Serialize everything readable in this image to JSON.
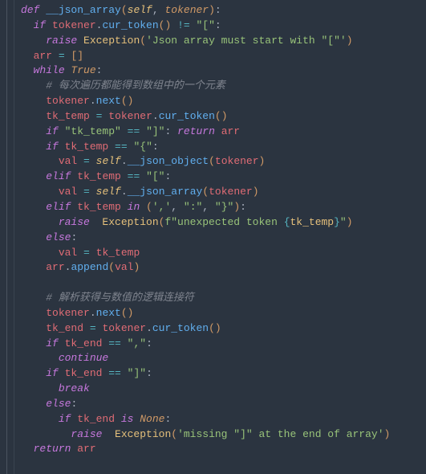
{
  "code": {
    "lines": [
      {
        "indent": 0,
        "tokens": [
          {
            "t": "def ",
            "c": "kw-def"
          },
          {
            "t": "__json_array",
            "c": "fn"
          },
          {
            "t": "(",
            "c": "brk"
          },
          {
            "t": "self",
            "c": "self"
          },
          {
            "t": ", ",
            "c": "punc"
          },
          {
            "t": "tokener",
            "c": "param"
          },
          {
            "t": ")",
            "c": "brk"
          },
          {
            "t": ":",
            "c": "punc"
          }
        ]
      },
      {
        "indent": 1,
        "tokens": [
          {
            "t": "if ",
            "c": "kw"
          },
          {
            "t": "tokener",
            "c": "var"
          },
          {
            "t": ".",
            "c": "punc"
          },
          {
            "t": "cur_token",
            "c": "call"
          },
          {
            "t": "() ",
            "c": "brk"
          },
          {
            "t": "!=",
            "c": "op"
          },
          {
            "t": " ",
            "c": "punc"
          },
          {
            "t": "\"[\"",
            "c": "str"
          },
          {
            "t": ":",
            "c": "punc"
          }
        ]
      },
      {
        "indent": 2,
        "tokens": [
          {
            "t": "raise ",
            "c": "kw"
          },
          {
            "t": "Exception",
            "c": "builtin"
          },
          {
            "t": "(",
            "c": "brk"
          },
          {
            "t": "'Json array must start with \"[\"'",
            "c": "str"
          },
          {
            "t": ")",
            "c": "brk"
          }
        ]
      },
      {
        "indent": 1,
        "tokens": [
          {
            "t": "arr ",
            "c": "var"
          },
          {
            "t": "=",
            "c": "op"
          },
          {
            "t": " []",
            "c": "brk"
          }
        ]
      },
      {
        "indent": 1,
        "tokens": [
          {
            "t": "while ",
            "c": "kw"
          },
          {
            "t": "True",
            "c": "none"
          },
          {
            "t": ":",
            "c": "punc"
          }
        ]
      },
      {
        "indent": 2,
        "tokens": [
          {
            "t": "# 每次遍历都能得到数组中的一个元素",
            "c": "comment"
          }
        ]
      },
      {
        "indent": 2,
        "tokens": [
          {
            "t": "tokener",
            "c": "var"
          },
          {
            "t": ".",
            "c": "punc"
          },
          {
            "t": "next",
            "c": "call"
          },
          {
            "t": "()",
            "c": "brk"
          }
        ]
      },
      {
        "indent": 2,
        "tokens": [
          {
            "t": "tk_temp ",
            "c": "var"
          },
          {
            "t": "=",
            "c": "op"
          },
          {
            "t": " ",
            "c": "punc"
          },
          {
            "t": "tokener",
            "c": "var"
          },
          {
            "t": ".",
            "c": "punc"
          },
          {
            "t": "cur_token",
            "c": "call"
          },
          {
            "t": "()",
            "c": "brk"
          }
        ]
      },
      {
        "indent": 2,
        "tokens": [
          {
            "t": "if ",
            "c": "kw"
          },
          {
            "t": "\"tk_temp\"",
            "c": "str"
          },
          {
            "t": " ",
            "c": "punc"
          },
          {
            "t": "==",
            "c": "op"
          },
          {
            "t": " ",
            "c": "punc"
          },
          {
            "t": "\"]\"",
            "c": "str"
          },
          {
            "t": ": ",
            "c": "punc"
          },
          {
            "t": "return ",
            "c": "kw"
          },
          {
            "t": "arr",
            "c": "var"
          }
        ]
      },
      {
        "indent": 2,
        "tokens": [
          {
            "t": "if ",
            "c": "kw"
          },
          {
            "t": "tk_temp ",
            "c": "var"
          },
          {
            "t": "==",
            "c": "op"
          },
          {
            "t": " ",
            "c": "punc"
          },
          {
            "t": "\"{\"",
            "c": "str"
          },
          {
            "t": ":",
            "c": "punc"
          }
        ]
      },
      {
        "indent": 3,
        "tokens": [
          {
            "t": "val ",
            "c": "var"
          },
          {
            "t": "=",
            "c": "op"
          },
          {
            "t": " ",
            "c": "punc"
          },
          {
            "t": "self",
            "c": "self"
          },
          {
            "t": ".",
            "c": "punc"
          },
          {
            "t": "__json_object",
            "c": "call"
          },
          {
            "t": "(",
            "c": "brk"
          },
          {
            "t": "tokener",
            "c": "var"
          },
          {
            "t": ")",
            "c": "brk"
          }
        ]
      },
      {
        "indent": 2,
        "tokens": [
          {
            "t": "elif ",
            "c": "kw"
          },
          {
            "t": "tk_temp ",
            "c": "var"
          },
          {
            "t": "==",
            "c": "op"
          },
          {
            "t": " ",
            "c": "punc"
          },
          {
            "t": "\"[\"",
            "c": "str"
          },
          {
            "t": ":",
            "c": "punc"
          }
        ]
      },
      {
        "indent": 3,
        "tokens": [
          {
            "t": "val ",
            "c": "var"
          },
          {
            "t": "=",
            "c": "op"
          },
          {
            "t": " ",
            "c": "punc"
          },
          {
            "t": "self",
            "c": "self"
          },
          {
            "t": ".",
            "c": "punc"
          },
          {
            "t": "__json_array",
            "c": "call"
          },
          {
            "t": "(",
            "c": "brk"
          },
          {
            "t": "tokener",
            "c": "var"
          },
          {
            "t": ")",
            "c": "brk"
          }
        ]
      },
      {
        "indent": 2,
        "tokens": [
          {
            "t": "elif ",
            "c": "kw"
          },
          {
            "t": "tk_temp ",
            "c": "var"
          },
          {
            "t": "in ",
            "c": "kw"
          },
          {
            "t": "(",
            "c": "brk"
          },
          {
            "t": "','",
            "c": "str"
          },
          {
            "t": ", ",
            "c": "punc"
          },
          {
            "t": "\":\"",
            "c": "str"
          },
          {
            "t": ", ",
            "c": "punc"
          },
          {
            "t": "\"}\"",
            "c": "str"
          },
          {
            "t": ")",
            "c": "brk"
          },
          {
            "t": ":",
            "c": "punc"
          }
        ]
      },
      {
        "indent": 3,
        "tokens": [
          {
            "t": "raise  ",
            "c": "kw"
          },
          {
            "t": "Exception",
            "c": "builtin"
          },
          {
            "t": "(",
            "c": "brk"
          },
          {
            "t": "f\"unexpected token ",
            "c": "str"
          },
          {
            "t": "{",
            "c": "op"
          },
          {
            "t": "tk_temp",
            "c": "fstr-int"
          },
          {
            "t": "}",
            "c": "op"
          },
          {
            "t": "\"",
            "c": "str"
          },
          {
            "t": ")",
            "c": "brk"
          }
        ]
      },
      {
        "indent": 2,
        "tokens": [
          {
            "t": "else",
            "c": "kw"
          },
          {
            "t": ":",
            "c": "punc"
          }
        ]
      },
      {
        "indent": 3,
        "tokens": [
          {
            "t": "val ",
            "c": "var"
          },
          {
            "t": "=",
            "c": "op"
          },
          {
            "t": " ",
            "c": "punc"
          },
          {
            "t": "tk_temp",
            "c": "var"
          }
        ]
      },
      {
        "indent": 2,
        "tokens": [
          {
            "t": "arr",
            "c": "var"
          },
          {
            "t": ".",
            "c": "punc"
          },
          {
            "t": "append",
            "c": "call"
          },
          {
            "t": "(",
            "c": "brk"
          },
          {
            "t": "val",
            "c": "var"
          },
          {
            "t": ")",
            "c": "brk"
          }
        ]
      },
      {
        "indent": 0,
        "tokens": [
          {
            "t": " ",
            "c": "punc"
          }
        ]
      },
      {
        "indent": 2,
        "tokens": [
          {
            "t": "# 解析获得与数值的逻辑连接符",
            "c": "comment"
          }
        ]
      },
      {
        "indent": 2,
        "tokens": [
          {
            "t": "tokener",
            "c": "var"
          },
          {
            "t": ".",
            "c": "punc"
          },
          {
            "t": "next",
            "c": "call"
          },
          {
            "t": "()",
            "c": "brk"
          }
        ]
      },
      {
        "indent": 2,
        "tokens": [
          {
            "t": "tk_end ",
            "c": "var"
          },
          {
            "t": "=",
            "c": "op"
          },
          {
            "t": " ",
            "c": "punc"
          },
          {
            "t": "tokener",
            "c": "var"
          },
          {
            "t": ".",
            "c": "punc"
          },
          {
            "t": "cur_token",
            "c": "call"
          },
          {
            "t": "()",
            "c": "brk"
          }
        ]
      },
      {
        "indent": 2,
        "tokens": [
          {
            "t": "if ",
            "c": "kw"
          },
          {
            "t": "tk_end ",
            "c": "var"
          },
          {
            "t": "==",
            "c": "op"
          },
          {
            "t": " ",
            "c": "punc"
          },
          {
            "t": "\",\"",
            "c": "str"
          },
          {
            "t": ":",
            "c": "punc"
          }
        ]
      },
      {
        "indent": 3,
        "tokens": [
          {
            "t": "continue",
            "c": "kw"
          }
        ]
      },
      {
        "indent": 2,
        "tokens": [
          {
            "t": "if ",
            "c": "kw"
          },
          {
            "t": "tk_end ",
            "c": "var"
          },
          {
            "t": "==",
            "c": "op"
          },
          {
            "t": " ",
            "c": "punc"
          },
          {
            "t": "\"]\"",
            "c": "str"
          },
          {
            "t": ":",
            "c": "punc"
          }
        ]
      },
      {
        "indent": 3,
        "tokens": [
          {
            "t": "break",
            "c": "kw"
          }
        ]
      },
      {
        "indent": 2,
        "tokens": [
          {
            "t": "else",
            "c": "kw"
          },
          {
            "t": ":",
            "c": "punc"
          }
        ]
      },
      {
        "indent": 3,
        "tokens": [
          {
            "t": "if ",
            "c": "kw"
          },
          {
            "t": "tk_end ",
            "c": "var"
          },
          {
            "t": "is ",
            "c": "kw"
          },
          {
            "t": "None",
            "c": "none"
          },
          {
            "t": ":",
            "c": "punc"
          }
        ]
      },
      {
        "indent": 4,
        "tokens": [
          {
            "t": "raise  ",
            "c": "kw"
          },
          {
            "t": "Exception",
            "c": "builtin"
          },
          {
            "t": "(",
            "c": "brk"
          },
          {
            "t": "'missing \"]\" at the end of array'",
            "c": "str"
          },
          {
            "t": ")",
            "c": "brk"
          }
        ]
      },
      {
        "indent": 1,
        "tokens": [
          {
            "t": "return ",
            "c": "kw"
          },
          {
            "t": "arr",
            "c": "var"
          }
        ]
      }
    ]
  },
  "indent_unit": "  "
}
